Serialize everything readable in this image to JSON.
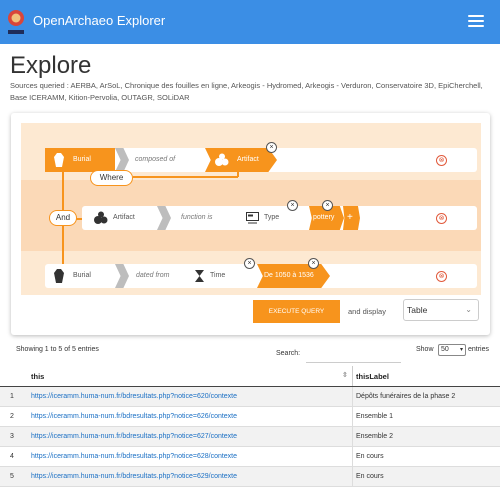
{
  "navbar": {
    "brand": "OpenArchaeo Explorer"
  },
  "page": {
    "title": "Explore",
    "sources": "Sources queried : AERBA, ArSoL, Chronique des fouilles en ligne, Arkeogis - Hydromed, Arkeogis - Verduron, Conservatoire 3D, EpiCherchell, Base ICERAMM, Kition-Pervolia, OUTAGR, SOLiDAR"
  },
  "query": {
    "row1": {
      "subject": "Burial",
      "predicate": "composed of",
      "object": "Artifact"
    },
    "where_label": "Where",
    "and_label": "And",
    "row2": {
      "subject": "Artifact",
      "predicate": "function is",
      "object": "Type",
      "value": "pottery",
      "add_label": "+"
    },
    "row3": {
      "subject": "Burial",
      "predicate": "dated from",
      "object": "Time",
      "value": "De 1050 à 1536"
    },
    "remove_glyph": "⊗",
    "close_glyph": "×",
    "execute_label": "EXECUTE QUERY",
    "display_label": "and display",
    "display_value": "Table",
    "colors": {
      "accent": "#f7941d",
      "navbar": "#3b8ee5"
    }
  },
  "results": {
    "info": "Showing 1 to 5 of 5 entries",
    "search_label": "Search:",
    "show_label": "Show",
    "show_value": "50",
    "entries_label": "entries",
    "columns": [
      "this",
      "thisLabel"
    ],
    "rows": [
      {
        "idx": "1",
        "this": "https://iceramm.huma-num.fr/bdresultats.php?notice=620/contexte",
        "label": "Dépôts funéraires de la phase 2"
      },
      {
        "idx": "2",
        "this": "https://iceramm.huma-num.fr/bdresultats.php?notice=626/contexte",
        "label": "Ensemble 1"
      },
      {
        "idx": "3",
        "this": "https://iceramm.huma-num.fr/bdresultats.php?notice=627/contexte",
        "label": "Ensemble 2"
      },
      {
        "idx": "4",
        "this": "https://iceramm.huma-num.fr/bdresultats.php?notice=628/contexte",
        "label": "En cours"
      },
      {
        "idx": "5",
        "this": "https://iceramm.huma-num.fr/bdresultats.php?notice=629/contexte",
        "label": "En cours"
      }
    ]
  }
}
